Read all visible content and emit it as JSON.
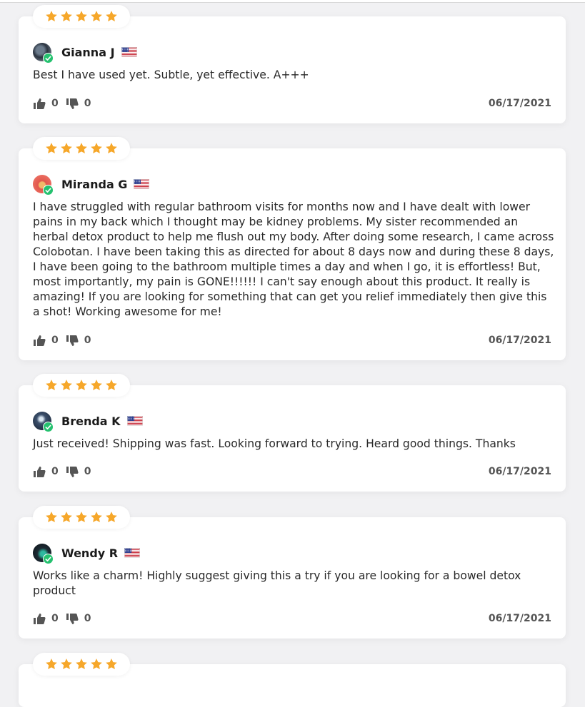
{
  "colors": {
    "star": "#f6a72a",
    "verified": "#25c16f",
    "thumb": "#555555"
  },
  "icons": {
    "star": "star-icon",
    "verified": "verified-check-icon",
    "flag": "us-flag-icon",
    "like": "thumbs-up-icon",
    "dislike": "thumbs-down-icon"
  },
  "reviews": [
    {
      "rating": 5,
      "name": "Gianna J",
      "text": "Best I have used yet. Subtle, yet effective. A+++",
      "likes": "0",
      "dislikes": "0",
      "date": "06/17/2021"
    },
    {
      "rating": 5,
      "name": "Miranda G",
      "text": "I have struggled with regular bathroom visits for months now and I have dealt with lower pains in my back which I thought may be kidney problems. My sister recommended an herbal detox product to help me flush out my body. After doing some research, I came across Colobotan. I have been taking this as directed for about 8 days now and during these 8 days, I have been going to the bathroom multiple times a day and when I go, it is effortless! But, most importantly, my pain is GONE!!!!!! I can't say enough about this product. It really is amazing! If you are looking for something that can get you relief immediately then give this a shot! Working awesome for me!",
      "likes": "0",
      "dislikes": "0",
      "date": "06/17/2021"
    },
    {
      "rating": 5,
      "name": "Brenda K",
      "text": "Just received! Shipping was fast. Looking forward to trying. Heard good things. Thanks",
      "likes": "0",
      "dislikes": "0",
      "date": "06/17/2021"
    },
    {
      "rating": 5,
      "name": "Wendy R",
      "text": "Works like a charm! Highly suggest giving this a try if you are looking for a bowel detox product",
      "likes": "0",
      "dislikes": "0",
      "date": "06/17/2021"
    },
    {
      "rating": 5
    }
  ]
}
